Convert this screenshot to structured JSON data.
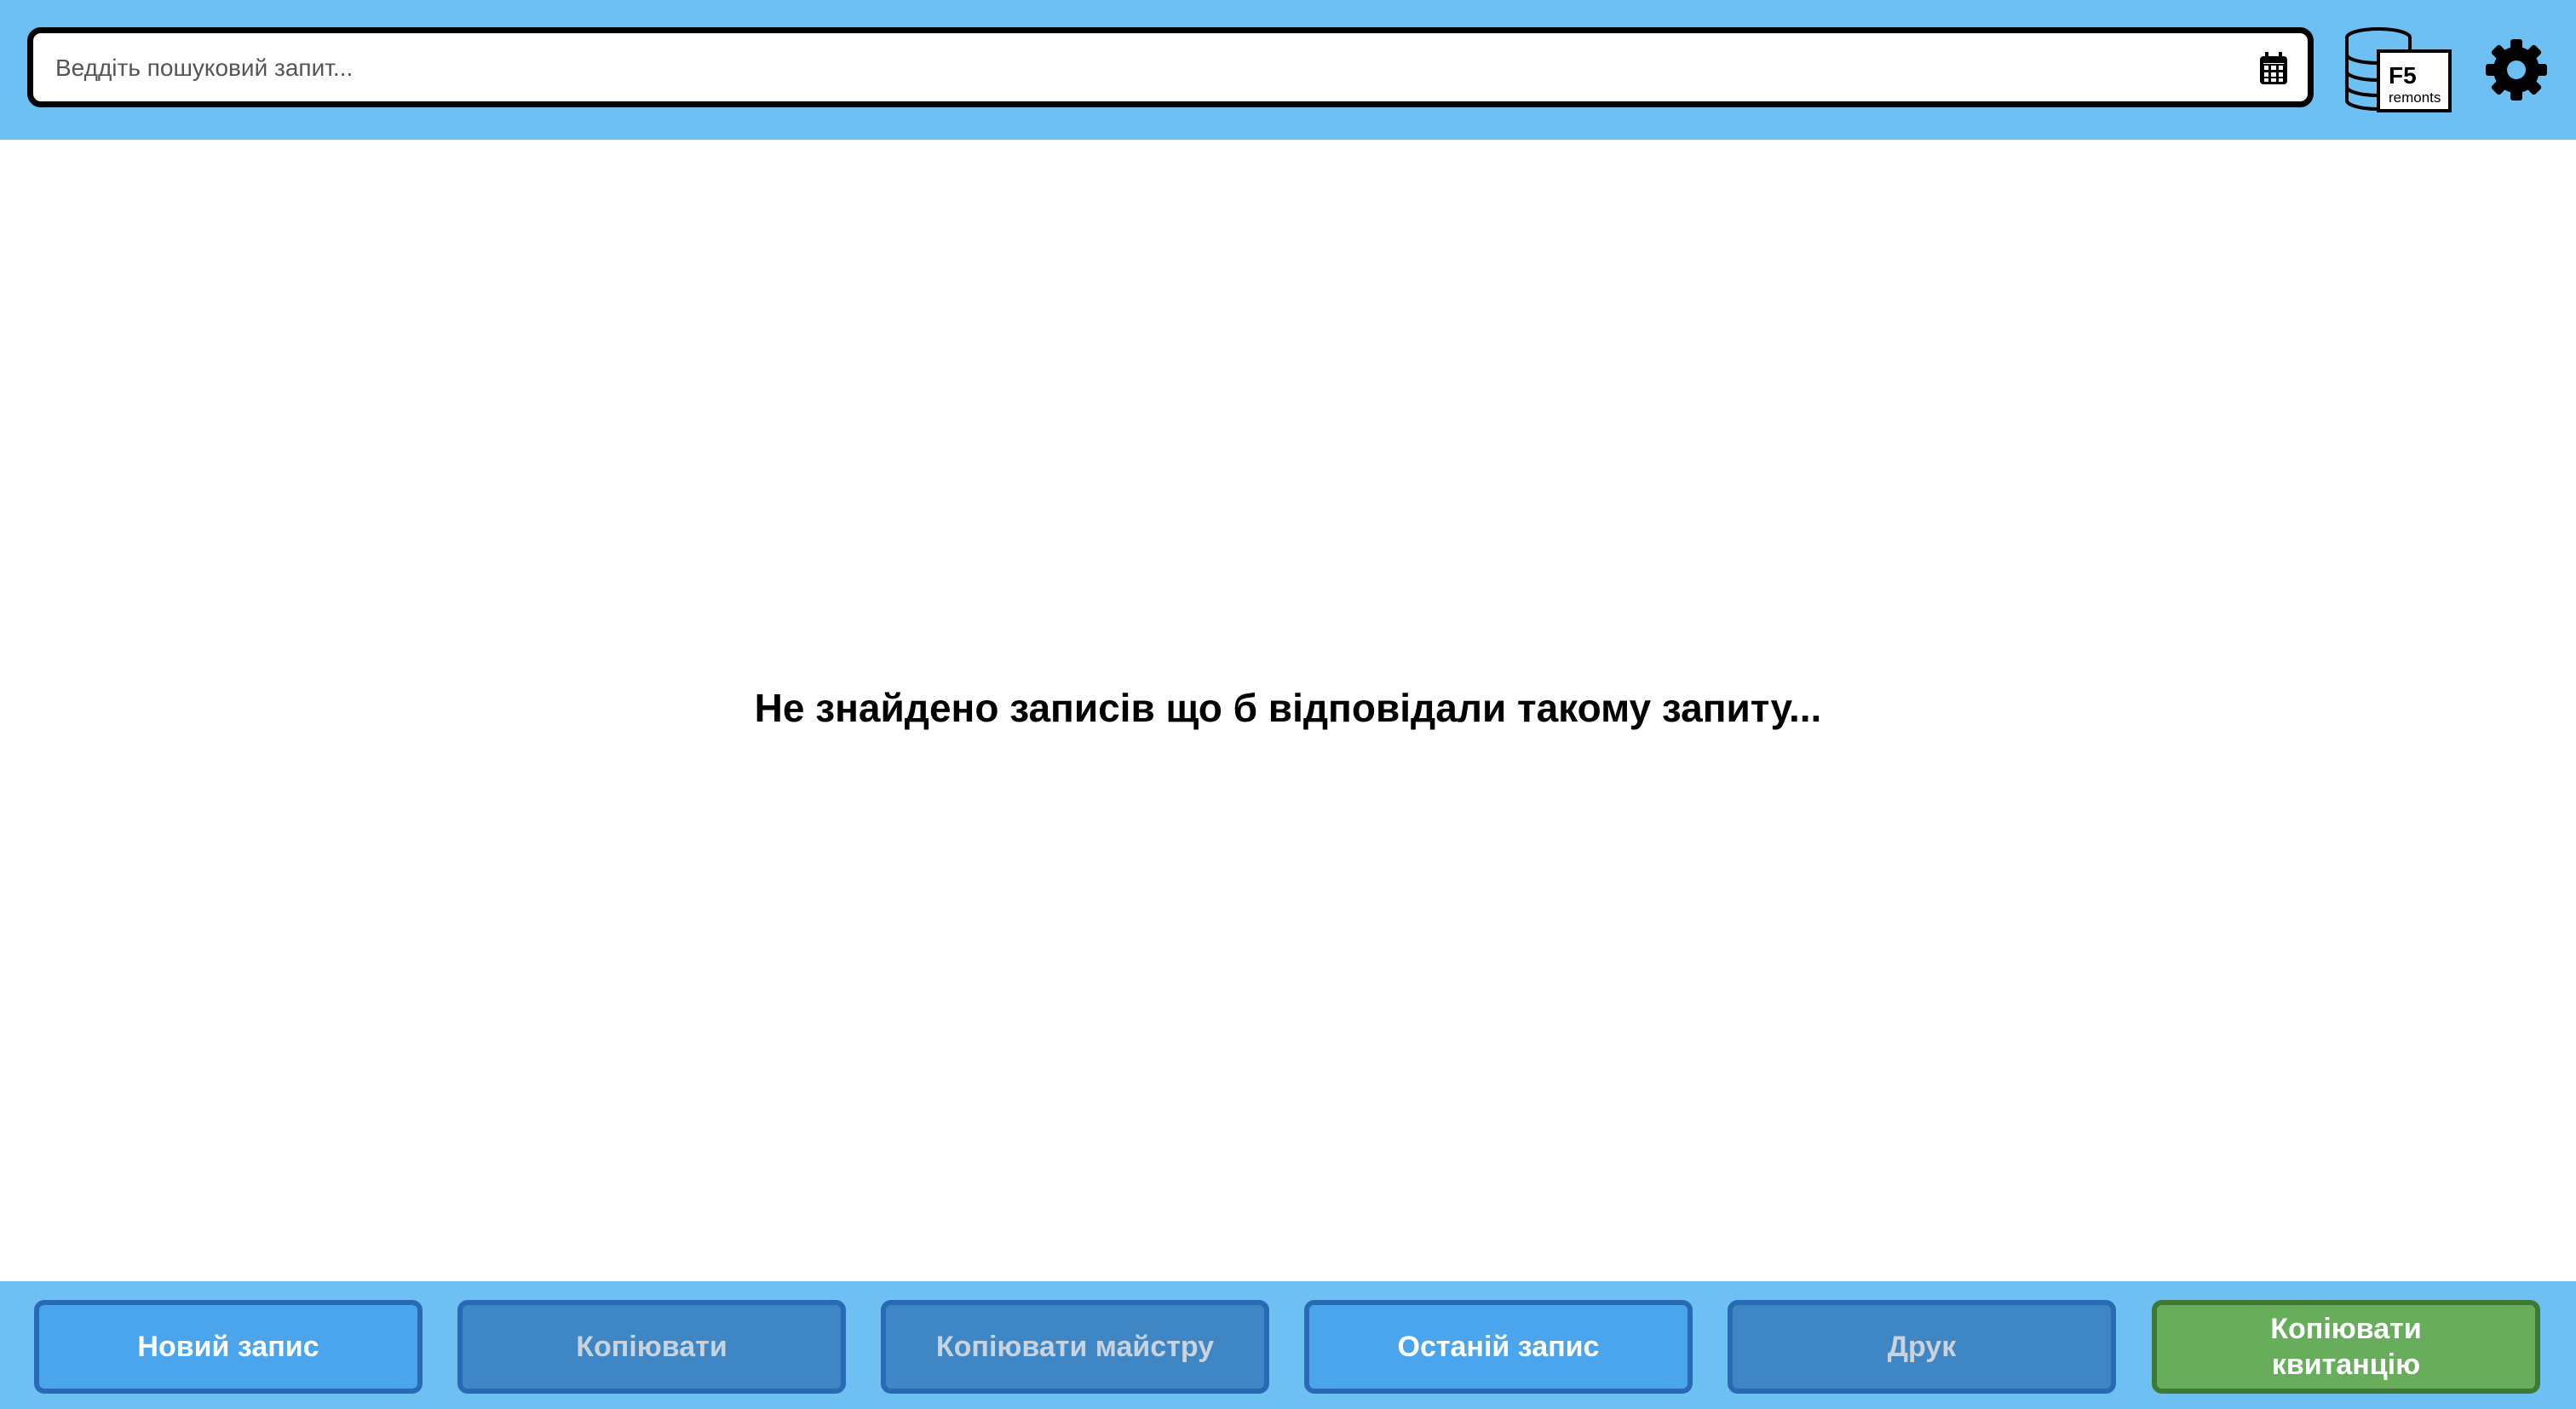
{
  "search": {
    "placeholder": "Веддіть пошуковий запит...",
    "value": ""
  },
  "icons": {
    "calendar": "calendar-icon",
    "logo": "f5-remonts-logo",
    "settings": "gear-icon"
  },
  "logo": {
    "text_main": "F5",
    "text_sub": "remonts"
  },
  "main": {
    "empty_message": "Не знайдено записів що б відповідали такому запиту..."
  },
  "footer": {
    "buttons": [
      {
        "label": "Новий запис",
        "state": "active"
      },
      {
        "label": "Копіювати",
        "state": "disabled"
      },
      {
        "label": "Копіювати майстру",
        "state": "disabled"
      },
      {
        "label": "Останій запис",
        "state": "active"
      },
      {
        "label": "Друк",
        "state": "disabled"
      },
      {
        "label": "Копіювати квитанцію",
        "state": "green"
      }
    ]
  },
  "colors": {
    "header_bg": "#6ebff2",
    "button_active": "#4aa5ec",
    "button_disabled": "#3f86c5",
    "button_green": "#67ad5b"
  }
}
